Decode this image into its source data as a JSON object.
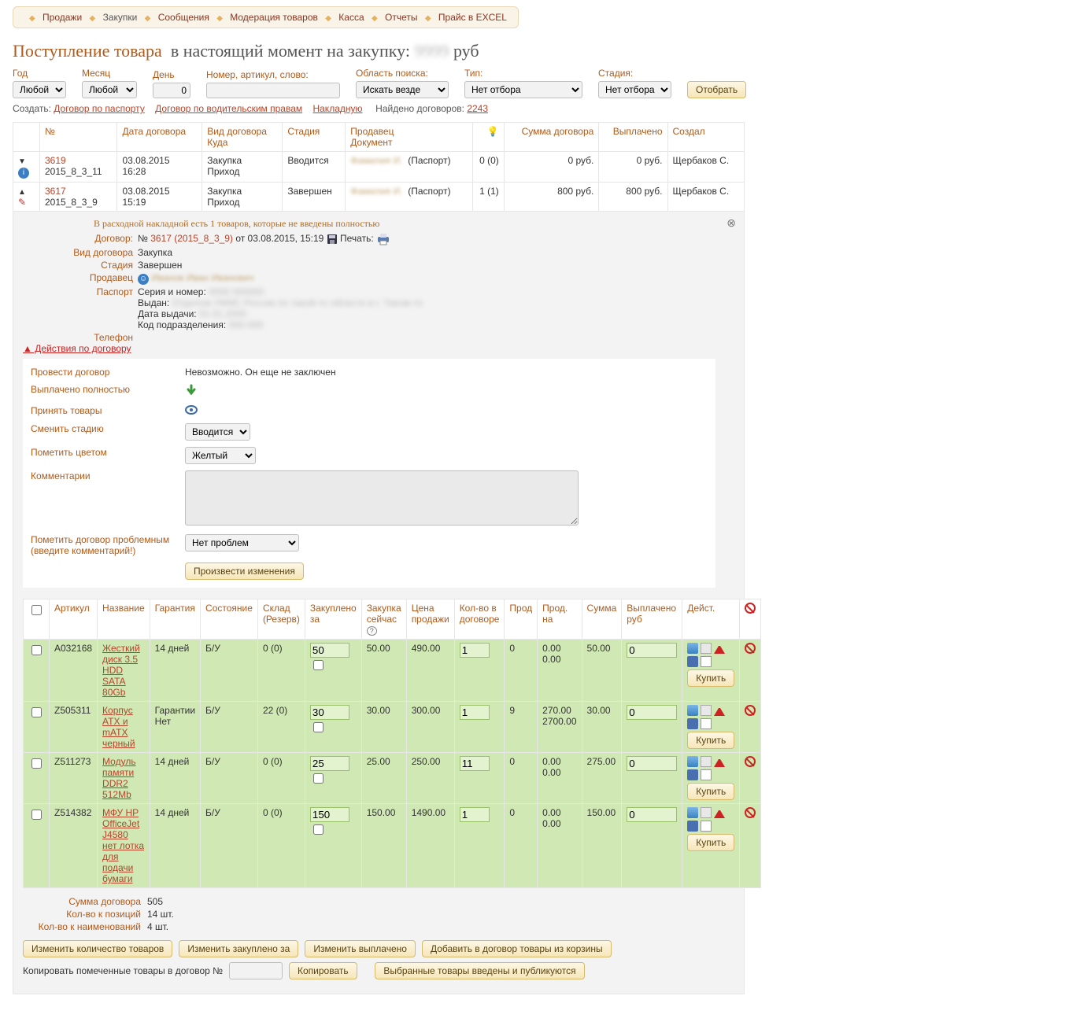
{
  "nav": [
    "Продажи",
    "Закупки",
    "Сообщения",
    "Модерация товаров",
    "Касса",
    "Отчеты",
    "Прайс в EXCEL"
  ],
  "nav_active_idx": 1,
  "page_title": "Поступление товара",
  "page_subtitle_prefix": "в настоящий момент на закупку:",
  "page_subtitle_suffix": "руб",
  "filters": {
    "year_label": "Год",
    "year_value": "Любой",
    "month_label": "Месяц",
    "month_value": "Любой",
    "day_label": "День",
    "day_value": "0",
    "search_label": "Номер, артикул, слово:",
    "scope_label": "Область поиска:",
    "scope_value": "Искать везде",
    "type_label": "Тип:",
    "type_value": "Нет отбора",
    "stage_label": "Стадия:",
    "stage_value": "Нет отбора",
    "submit": "Отобрать"
  },
  "create_row": {
    "create_label": "Создать:",
    "links": [
      "Договор по паспорту",
      "Договор по водительским правам",
      "Накладную"
    ],
    "found_label": "Найдено договоров:",
    "found_count": "2243"
  },
  "thead": {
    "num": "№",
    "date": "Дата договора",
    "type1": "Вид договора",
    "type2": "Куда",
    "stage": "Стадия",
    "seller1": "Продавец",
    "seller2": "Документ",
    "qty_hdr": "",
    "sum": "Сумма договора",
    "paid": "Выплачено",
    "created": "Создал"
  },
  "rows": [
    {
      "num": "3619",
      "code": "2015_8_3_11",
      "date": "03.08.2015",
      "time": "16:28",
      "kind": "Закупка",
      "dest": "Приход",
      "stage": "Вводится",
      "doc": "(Паспорт)",
      "qty": "0 (0)",
      "sum": "0 руб.",
      "paid": "0 руб.",
      "who": "Щербаков С.",
      "tri": "▼"
    },
    {
      "num": "3617",
      "code": "2015_8_3_9",
      "date": "03.08.2015",
      "time": "15:19",
      "kind": "Закупка",
      "dest": "Приход",
      "stage": "Завершен",
      "doc": "(Паспорт)",
      "qty": "1 (1)",
      "sum": "800 руб.",
      "paid": "800 руб.",
      "who": "Щербаков С.",
      "tri": "▲"
    }
  ],
  "panel": {
    "warning": "В расходной накладной есть 1 товаров, которые не введены полностью",
    "dogovor_k": "Договор:",
    "dogovor_num_prefix": "№ ",
    "dogovor_link": "3617 (2015_8_3_9)",
    "dogovor_date": " от 03.08.2015, 15:19",
    "print_label": "Печать:",
    "kv": {
      "kind_k": "Вид договора",
      "kind_v": "Закупка",
      "stage_k": "Стадия",
      "stage_v": "Завершен",
      "seller_k": "Продавец",
      "passport_k": "Паспорт",
      "series_l": "Серия и номер:",
      "issued_l": "Выдан:",
      "date_l": "Дата выдачи:",
      "code_l": "Код подразделения:",
      "phone_k": "Телефон"
    },
    "actions_link": "▲ Действия по договору"
  },
  "actions": {
    "run_k": "Провести договор",
    "run_v": "Невозможно. Он еще не заключен",
    "paid_k": "Выплачено полностью",
    "accept_k": "Принять товары",
    "stage_k": "Сменить стадию",
    "stage_v": "Вводится",
    "color_k": "Пометить цветом",
    "color_v": "Желтый",
    "comment_k": "Комментарии",
    "problem_k": "Пометить договор проблемным (введите комментарий!)",
    "problem_v": "Нет проблем",
    "submit": "Произвести изменения"
  },
  "ithead": {
    "art": "Артикул",
    "name": "Название",
    "war": "Гарантия",
    "cond": "Состояние",
    "stock": "Склад (Резерв)",
    "bought": "Закуплено за",
    "now": "Закупка сейчас",
    "price": "Цена продажи",
    "qty": "Кол-во в договоре",
    "sold": "Прод",
    "soldfor": "Прод. на",
    "sum": "Сумма",
    "paid": "Выплачено руб",
    "act": "Дейст."
  },
  "items": [
    {
      "art": "A032168",
      "name": "Жесткий диск 3.5 HDD SATA 80Gb",
      "war": "14 дней",
      "cond": "Б/У",
      "stock": "0 (0)",
      "bought": "50",
      "now": "50.00",
      "price": "490.00",
      "qty": "1",
      "sold": "0",
      "soldfor1": "0.00",
      "soldfor2": "0.00",
      "sum": "50.00",
      "paid": "0"
    },
    {
      "art": "Z505311",
      "name": "Корпус ATX и mATX черный",
      "war": "Гарантии Нет",
      "cond": "Б/У",
      "stock": "22 (0)",
      "bought": "30",
      "now": "30.00",
      "price": "300.00",
      "qty": "1",
      "sold": "9",
      "soldfor1": "270.00",
      "soldfor2": "2700.00",
      "sum": "30.00",
      "paid": "0"
    },
    {
      "art": "Z511273",
      "name": "Модуль памяти DDR2 512Mb",
      "war": "14 дней",
      "cond": "Б/У",
      "stock": "0 (0)",
      "bought": "25",
      "now": "25.00",
      "price": "250.00",
      "qty": "11",
      "sold": "0",
      "soldfor1": "0.00",
      "soldfor2": "0.00",
      "sum": "275.00",
      "paid": "0"
    },
    {
      "art": "Z514382",
      "name": "МФУ HP OfficeJet J4580 нет лотка для подачи бумаги",
      "war": "14 дней",
      "cond": "Б/У",
      "stock": "0 (0)",
      "bought": "150",
      "now": "150.00",
      "price": "1490.00",
      "qty": "1",
      "sold": "0",
      "soldfor1": "0.00",
      "soldfor2": "0.00",
      "sum": "150.00",
      "paid": "0"
    }
  ],
  "buy_btn": "Купить",
  "totals": {
    "sum_k": "Сумма договора",
    "sum_v": "505",
    "pos_k": "Кол-во к позиций",
    "pos_v": "14 шт.",
    "names_k": "Кол-во к наименований",
    "names_v": "4 шт."
  },
  "bulk": [
    "Изменить количество товаров",
    "Изменить закуплено за",
    "Изменить выплачено",
    "Добавить в договор товары из корзины"
  ],
  "copy_row": {
    "label": "Копировать помеченные товары в договор №",
    "btn": "Копировать",
    "btn2": "Выбранные товары введены и публикуются"
  }
}
